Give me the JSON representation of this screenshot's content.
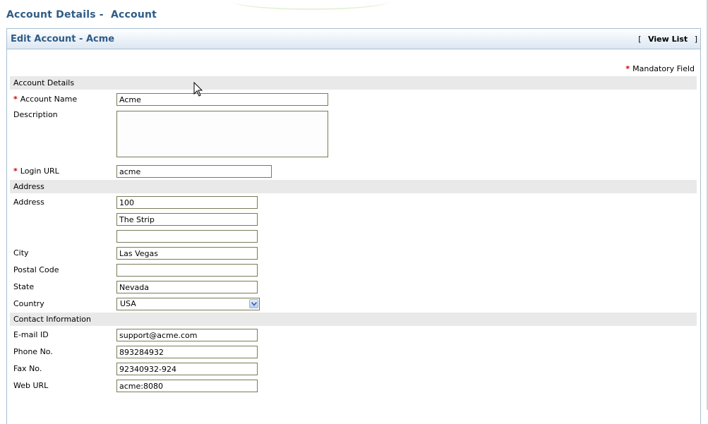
{
  "page": {
    "title": "Account Details -  Account"
  },
  "panel": {
    "title": "Edit Account - Acme",
    "view_list_open": "[",
    "view_list_label": "View List",
    "view_list_close": "]",
    "mandatory_star": "*",
    "mandatory_note": "Mandatory Field"
  },
  "sections": {
    "account": "Account Details",
    "address": "Address",
    "contact": "Contact Information"
  },
  "fields": {
    "account_name": {
      "label": "Account Name",
      "value": "Acme",
      "required": "*"
    },
    "description": {
      "label": "Description",
      "value": ""
    },
    "login_url": {
      "label": "Login URL",
      "value": "acme",
      "required": "*"
    },
    "address": {
      "label": "Address",
      "line1": "100",
      "line2": "The Strip",
      "line3": ""
    },
    "city": {
      "label": "City",
      "value": "Las Vegas"
    },
    "postal_code": {
      "label": "Postal Code",
      "value": ""
    },
    "state": {
      "label": "State",
      "value": "Nevada"
    },
    "country": {
      "label": "Country",
      "value": "USA"
    },
    "email": {
      "label": "E-mail ID",
      "value": "support@acme.com"
    },
    "phone": {
      "label": "Phone No.",
      "value": "893284932"
    },
    "fax": {
      "label": "Fax No.",
      "value": "92340932-924"
    },
    "web_url": {
      "label": "Web URL",
      "value": "acme:8080"
    }
  },
  "colors": {
    "title": "#2f5c87",
    "required": "#cc0000",
    "section_bg": "#e9e9e9",
    "panel_border": "#a9bfd4"
  }
}
